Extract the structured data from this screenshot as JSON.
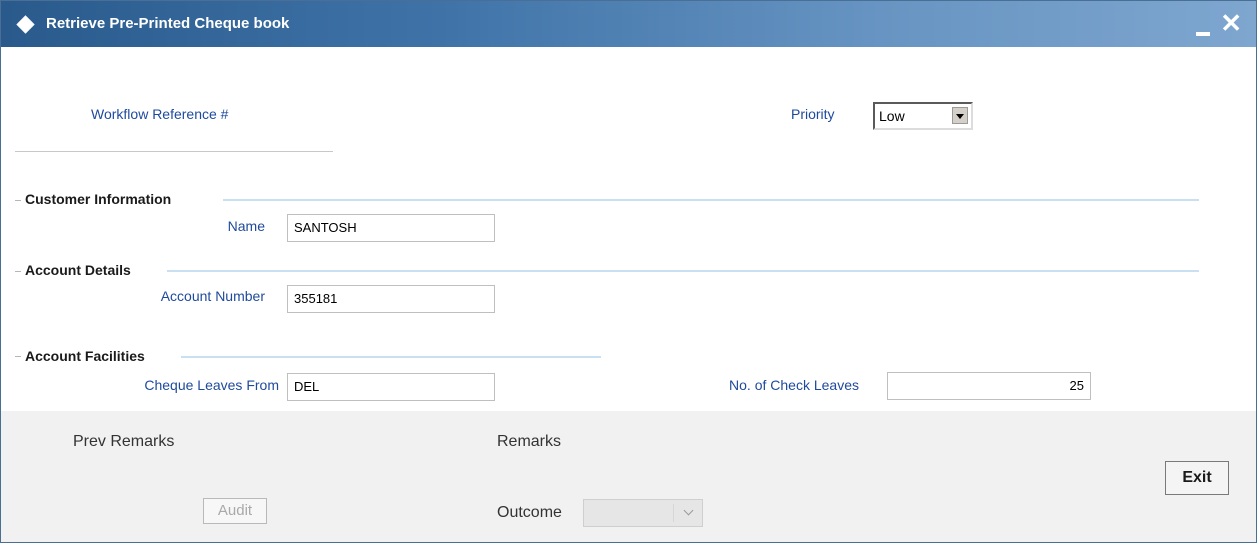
{
  "window": {
    "title": "Retrieve Pre-Printed Cheque book",
    "icons": {
      "app": "diamond-icon",
      "minimize": "minimize-icon",
      "close": "close-icon"
    },
    "close_glyph": "✕"
  },
  "header": {
    "workflow_label": "Workflow Reference #",
    "priority_label": "Priority",
    "priority_value": "Low"
  },
  "customer": {
    "section_title": "Customer Information",
    "name_label": "Name",
    "name_value": "SANTOSH"
  },
  "account": {
    "section_title": "Account Details",
    "number_label": "Account Number",
    "number_value": "355181"
  },
  "facilities": {
    "section_title": "Account Facilities",
    "from_label": "Cheque Leaves From",
    "from_value": "DEL",
    "leaves_label": "No. of Check Leaves",
    "leaves_value": "25"
  },
  "footer": {
    "prev_remarks_label": "Prev Remarks",
    "remarks_label": "Remarks",
    "audit_label": "Audit",
    "outcome_label": "Outcome",
    "outcome_value": "",
    "exit_label": "Exit"
  },
  "colors": {
    "title_bar": "#2a5a8c",
    "label_blue": "#1f4a9c",
    "footer_bg": "#f1f1f1"
  }
}
